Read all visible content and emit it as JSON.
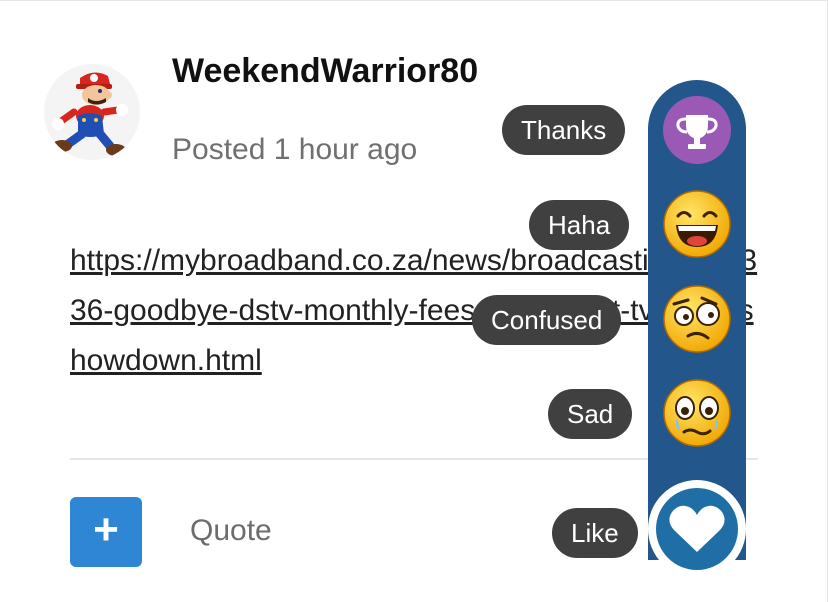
{
  "post": {
    "username": "WeekendWarrior80",
    "posted": "Posted 1 hour ago",
    "link": "https://mybroadband.co.za/news/broadcasting/504336-goodbye-dstv-monthly-fees-and-smart-tv-price-showdown.html"
  },
  "actions": {
    "add_symbol": "+",
    "quote_label": "Quote"
  },
  "reactions": {
    "items": [
      {
        "label": "Thanks",
        "icon": "trophy-icon"
      },
      {
        "label": "Haha",
        "icon": "laughing-face-icon"
      },
      {
        "label": "Confused",
        "icon": "confused-face-icon"
      },
      {
        "label": "Sad",
        "icon": "sad-face-icon"
      }
    ],
    "like_label": "Like",
    "like_icon": "heart-icon"
  },
  "colors": {
    "rail": "#23568a",
    "like": "#1f6fa6",
    "add_button": "#2f86d4",
    "pill": "#404040",
    "thanks": "#9b59b6"
  }
}
